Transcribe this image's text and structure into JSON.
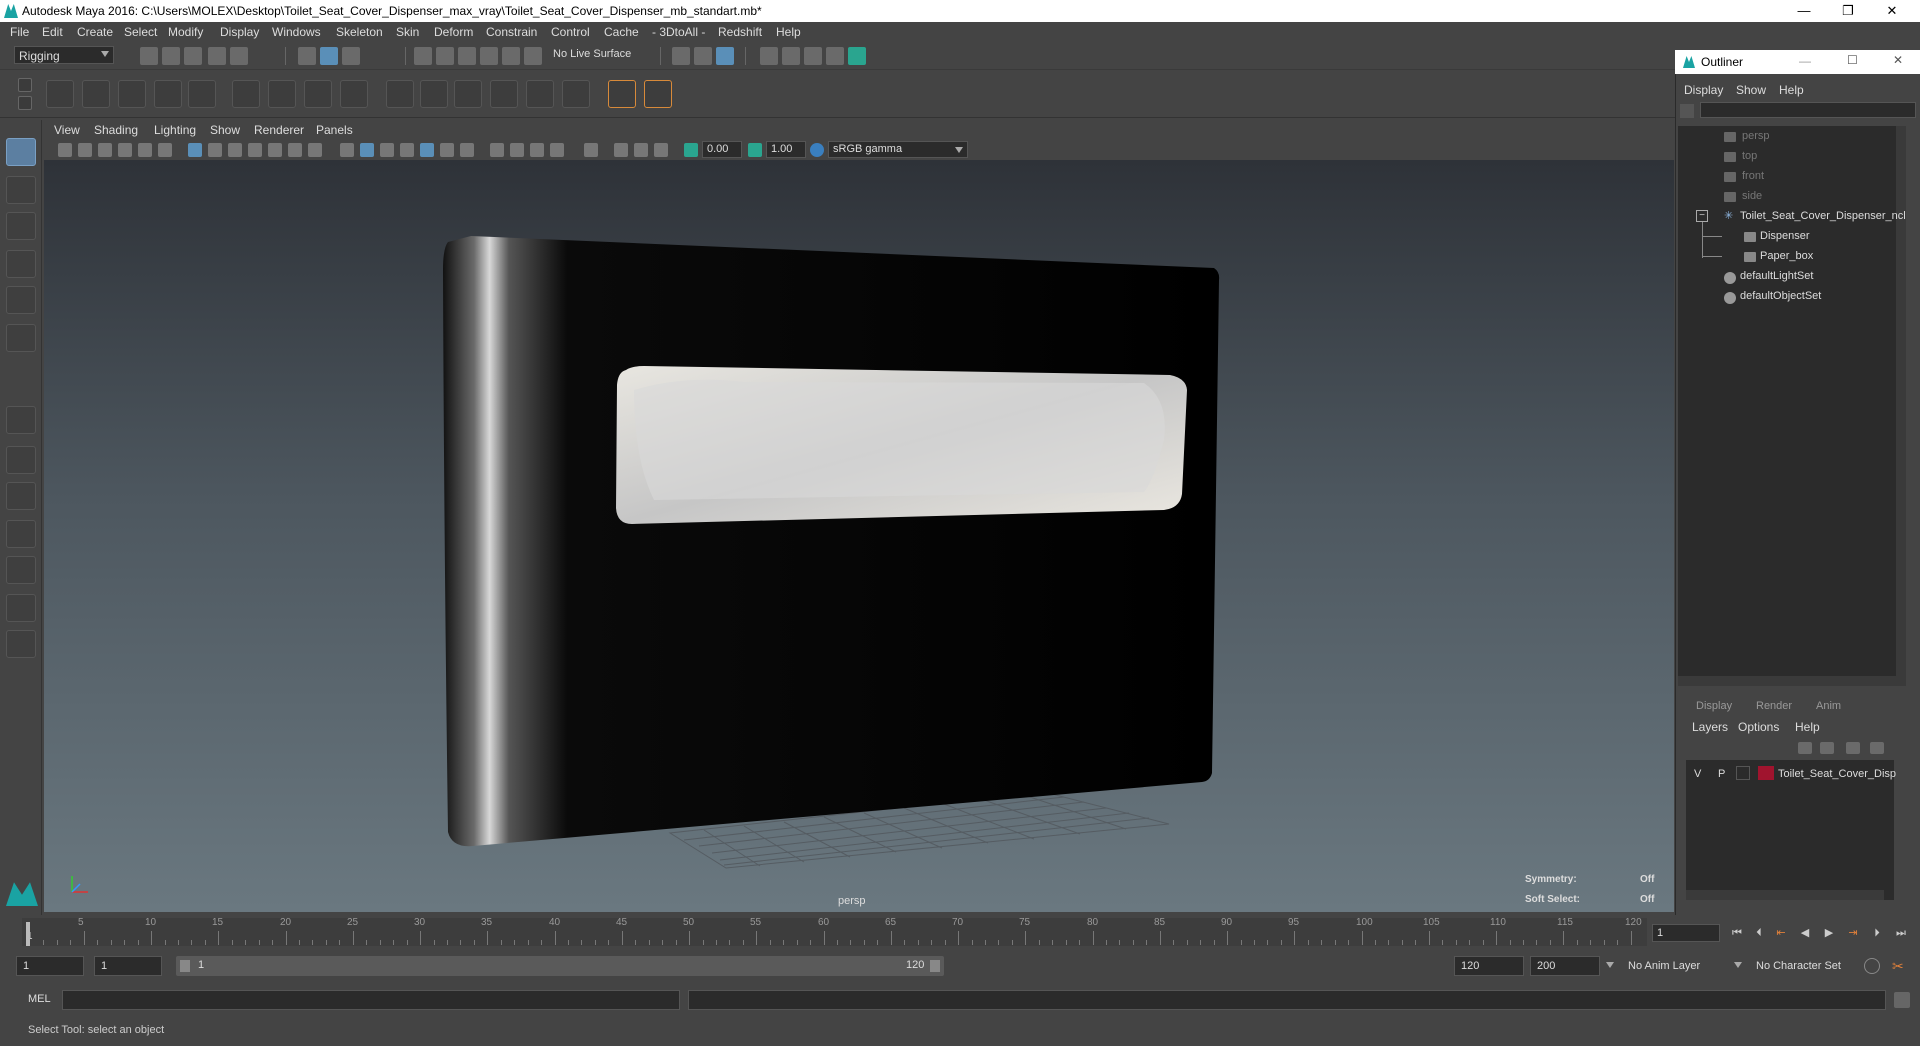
{
  "window": {
    "title": "Autodesk Maya 2016: C:\\Users\\MOLEX\\Desktop\\Toilet_Seat_Cover_Dispenser_max_vray\\Toilet_Seat_Cover_Dispenser_mb_standart.mb*",
    "minimize": "—",
    "restore": "❐",
    "close": "✕"
  },
  "menubar": [
    "File",
    "Edit",
    "Create",
    "Select",
    "Modify",
    "Display",
    "Windows",
    "Skeleton",
    "Skin",
    "Deform",
    "Constrain",
    "Control",
    "Cache",
    "- 3DtoAll -",
    "Redshift",
    "Help"
  ],
  "statusline": {
    "mode": "Rigging",
    "live_surface": "No Live Surface"
  },
  "viewport": {
    "menu": [
      "View",
      "Shading",
      "Lighting",
      "Show",
      "Renderer",
      "Panels"
    ],
    "exposure": "0.00",
    "gamma": "1.00",
    "color_space": "sRGB gamma",
    "camera_label": "persp",
    "symmetry_label": "Symmetry:",
    "symmetry_value": "Off",
    "soft_select_label": "Soft Select:",
    "soft_select_value": "Off"
  },
  "outliner": {
    "title": "Outliner",
    "menu": [
      "Display",
      "Show",
      "Help"
    ],
    "items": [
      {
        "label": "persp",
        "dim": true
      },
      {
        "label": "top",
        "dim": true
      },
      {
        "label": "front",
        "dim": true
      },
      {
        "label": "side",
        "dim": true
      },
      {
        "label": "Toilet_Seat_Cover_Dispenser_ncl",
        "dim": false
      },
      {
        "label": "Dispenser",
        "dim": false
      },
      {
        "label": "Paper_box",
        "dim": false
      },
      {
        "label": "defaultLightSet",
        "dim": false
      },
      {
        "label": "defaultObjectSet",
        "dim": false
      }
    ]
  },
  "layers": {
    "tabs": [
      "Display",
      "Render",
      "Anim"
    ],
    "menu": [
      "Layers",
      "Options",
      "Help"
    ],
    "row": {
      "v": "V",
      "p": "P",
      "name": "Toilet_Seat_Cover_Disp",
      "color": "#a0142e"
    }
  },
  "timeline": {
    "ticks": [
      "5",
      "10",
      "15",
      "20",
      "25",
      "30",
      "35",
      "40",
      "45",
      "50",
      "55",
      "60",
      "65",
      "70",
      "75",
      "80",
      "85",
      "90",
      "95",
      "100",
      "105",
      "110",
      "115",
      "120"
    ],
    "start_label": "1",
    "current_frame": "1"
  },
  "range": {
    "start": "1",
    "playback_start": "1",
    "slider_start": "1",
    "slider_end": "120",
    "playback_end": "120",
    "end": "200",
    "anim_layer": "No Anim Layer",
    "character_set": "No Character Set"
  },
  "cmdline": {
    "label": "MEL"
  },
  "helpline": {
    "text": "Select Tool: select an object"
  }
}
